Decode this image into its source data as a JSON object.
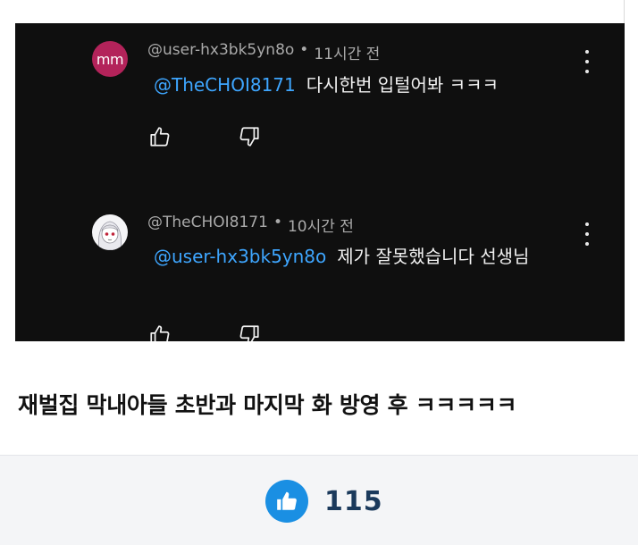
{
  "comments": [
    {
      "avatar_text": "mm",
      "avatar_color": "#b3235a",
      "author": "@user-hx3bk5yn8o",
      "time": "11시간 전",
      "mention": "@TheCHOI8171",
      "text": "다시한번 입털어봐 ㅋㅋㅋ"
    },
    {
      "avatar_icon": "anime-girl-avatar",
      "author": "@TheCHOI8171",
      "time": "10시간 전",
      "mention": "@user-hx3bk5yn8o",
      "text": "제가 잘못했습니다 선생님"
    }
  ],
  "separator": "•",
  "icons": {
    "like": "thumbs-up-icon",
    "dislike": "thumbs-down-icon",
    "more": "more-vert-icon"
  },
  "caption": "재벌집 막내아들 초반과 마지막 화 방영 후 ㅋㅋㅋㅋㅋ",
  "footer": {
    "like_count": "115",
    "like_color": "#1a8fe3"
  }
}
